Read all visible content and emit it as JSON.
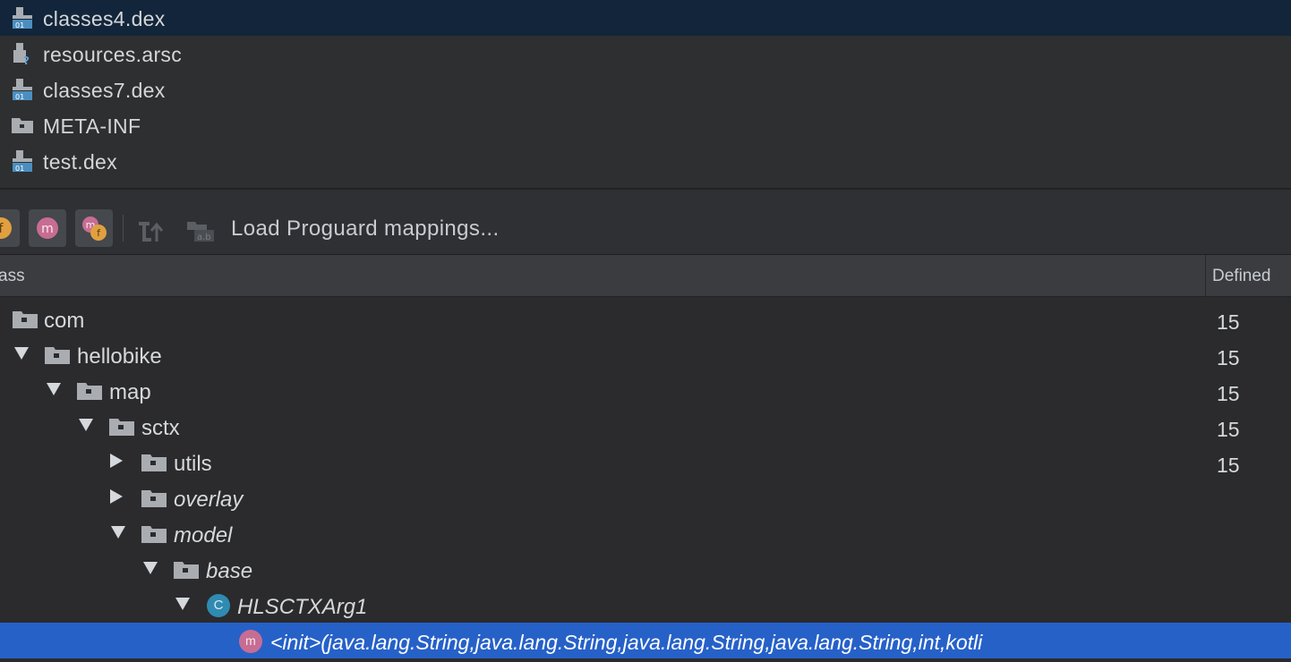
{
  "files": [
    {
      "label": "classes4.dex",
      "icon": "dex-file-icon",
      "selected": true
    },
    {
      "label": "resources.arsc",
      "icon": "unknown-file-icon",
      "selected": false
    },
    {
      "label": "classes7.dex",
      "icon": "dex-file-icon",
      "selected": false
    },
    {
      "label": "META-INF",
      "icon": "folder-icon",
      "selected": false
    },
    {
      "label": "test.dex",
      "icon": "dex-file-icon",
      "selected": false
    }
  ],
  "toolbar": {
    "field_icon_glyph": "f",
    "method_icon_glyph": "m",
    "fields_methods_icon_glyph_m": "m",
    "fields_methods_icon_glyph_f": "f",
    "load_mappings_label": "Load Proguard mappings..."
  },
  "columns": {
    "class": "ass",
    "defined": "Defined"
  },
  "tree": {
    "rows": [
      {
        "label": "com",
        "count": "15"
      },
      {
        "label": "hellobike",
        "count": "15"
      },
      {
        "label": "map",
        "count": "15"
      },
      {
        "label": "sctx",
        "count": "15"
      },
      {
        "label": "utils",
        "count": "15"
      },
      {
        "label": "overlay",
        "count": ""
      },
      {
        "label": "model",
        "count": ""
      },
      {
        "label": "base",
        "count": ""
      },
      {
        "label": "HLSCTXArg1",
        "count": "",
        "icon_glyph": "C"
      },
      {
        "label": "<init>(java.lang.String,java.lang.String,java.lang.String,java.lang.String,int,kotli",
        "count": "",
        "icon_glyph": "m"
      }
    ]
  },
  "colors": {
    "selection_top": "#12253a",
    "selection_tree": "#2661c8",
    "field_badge": "#e0a040",
    "method_badge": "#c76d93",
    "class_badge": "#2f8bb2"
  }
}
